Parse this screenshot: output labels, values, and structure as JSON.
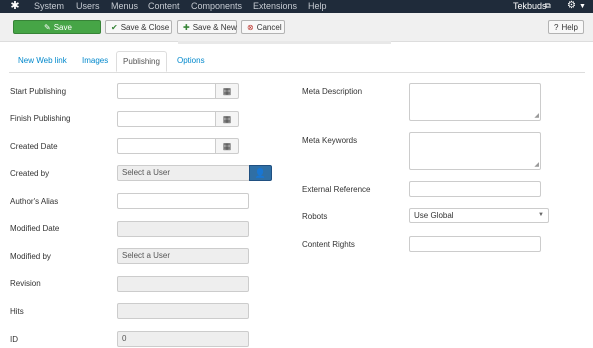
{
  "topbar": {
    "menu": [
      "System",
      "Users",
      "Menus",
      "Content",
      "Components",
      "Extensions",
      "Help"
    ],
    "user": "Tekbuds"
  },
  "toolbar": {
    "save": "Save",
    "save_close": "Save & Close",
    "save_new": "Save & New",
    "cancel": "Cancel",
    "help": "Help"
  },
  "tabs": [
    "New Web link",
    "Images",
    "Publishing",
    "Options"
  ],
  "left_fields": {
    "start_publishing": {
      "label": "Start Publishing",
      "value": ""
    },
    "finish_publishing": {
      "label": "Finish Publishing",
      "value": ""
    },
    "created_date": {
      "label": "Created Date",
      "value": ""
    },
    "created_by": {
      "label": "Created by",
      "value": "Select a User"
    },
    "authors_alias": {
      "label": "Author's Alias",
      "value": ""
    },
    "modified_date": {
      "label": "Modified Date",
      "value": ""
    },
    "modified_by": {
      "label": "Modified by",
      "value": "Select a User"
    },
    "revision": {
      "label": "Revision",
      "value": ""
    },
    "hits": {
      "label": "Hits",
      "value": ""
    },
    "id": {
      "label": "ID",
      "value": "0"
    }
  },
  "right_fields": {
    "meta_description": {
      "label": "Meta Description",
      "value": ""
    },
    "meta_keywords": {
      "label": "Meta Keywords",
      "value": ""
    },
    "external_reference": {
      "label": "External Reference",
      "value": ""
    },
    "robots": {
      "label": "Robots",
      "value": "Use Global"
    },
    "content_rights": {
      "label": "Content Rights",
      "value": ""
    }
  },
  "colors": {
    "topbar_bg": "#1f2b3a",
    "save_green": "#46a546",
    "user_button_blue": "#2f6fa5",
    "link_blue": "#0088cc"
  }
}
